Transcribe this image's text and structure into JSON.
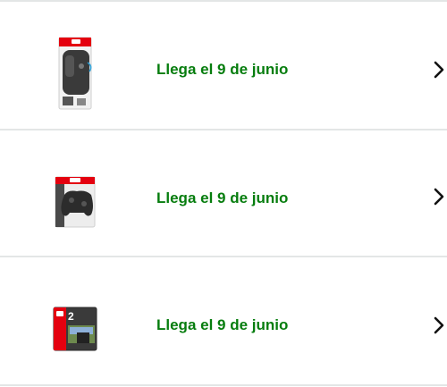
{
  "orders": [
    {
      "product_icon": "joycon-grip-package-icon",
      "delivery_text": "Llega el 9 de junio",
      "chevron_icon": "chevron-right-icon"
    },
    {
      "product_icon": "pro-controller-package-icon",
      "delivery_text": "Llega el 9 de junio",
      "chevron_icon": "chevron-right-icon"
    },
    {
      "product_icon": "switch-2-console-package-icon",
      "delivery_text": "Llega el 9 de junio",
      "chevron_icon": "chevron-right-icon"
    }
  ],
  "colors": {
    "delivery_green": "#067d0e",
    "divider": "#e3e6e6",
    "nintendo_red": "#e4000f"
  }
}
